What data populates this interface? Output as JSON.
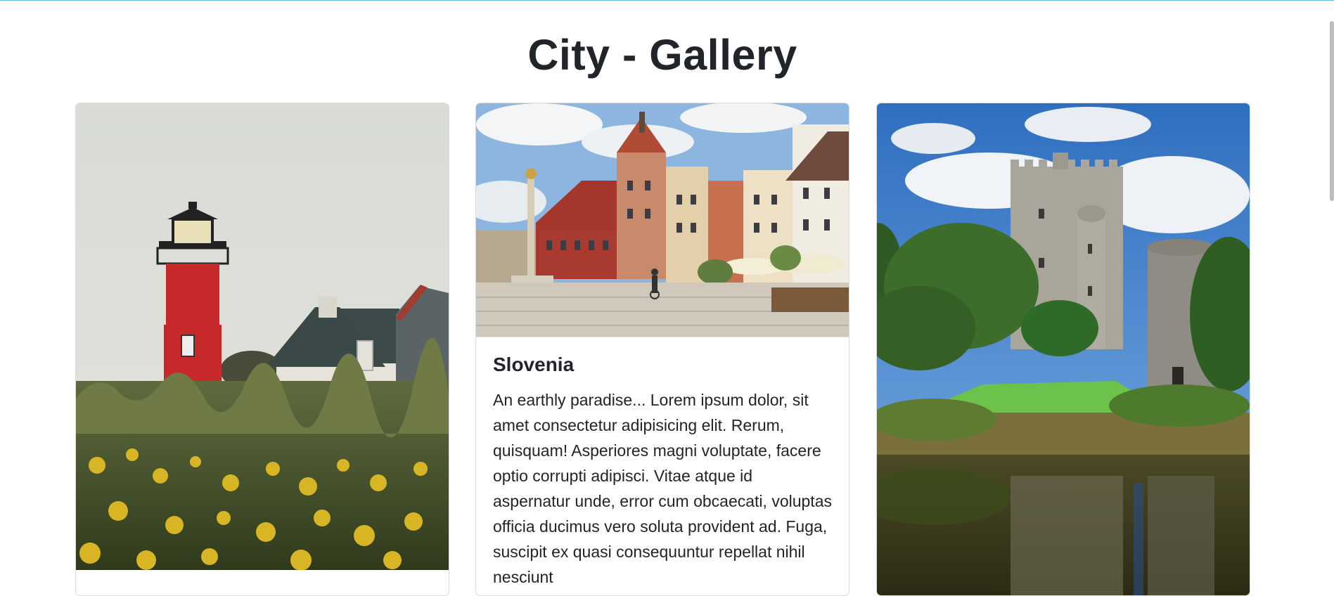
{
  "page": {
    "title": "City - Gallery"
  },
  "cards": [
    {
      "image_alt": "Red and white lighthouse beside houses behind a field of yellow flowers",
      "title": "",
      "text": ""
    },
    {
      "image_alt": "Town square with colorful historic buildings and a column monument in Slovenia",
      "title": "Slovenia",
      "text": "An earthly paradise... Lorem ipsum dolor, sit amet consectetur adipisicing elit. Rerum, quisquam! Asperiores magni voluptate, facere optio corrupti adipisci. Vitae atque id aspernatur unde, error cum obcaecati, voluptas officia ducimus vero soluta provident ad. Fuga, suscipit ex quasi consequuntur repellat nihil nesciunt"
    },
    {
      "image_alt": "Stone castle and round tower reflected in a pond surrounded by greenery",
      "title": "",
      "text": ""
    }
  ],
  "colors": {
    "accent_line": "#5bc0de",
    "text": "#212529",
    "card_border": "#dcdcdc"
  }
}
